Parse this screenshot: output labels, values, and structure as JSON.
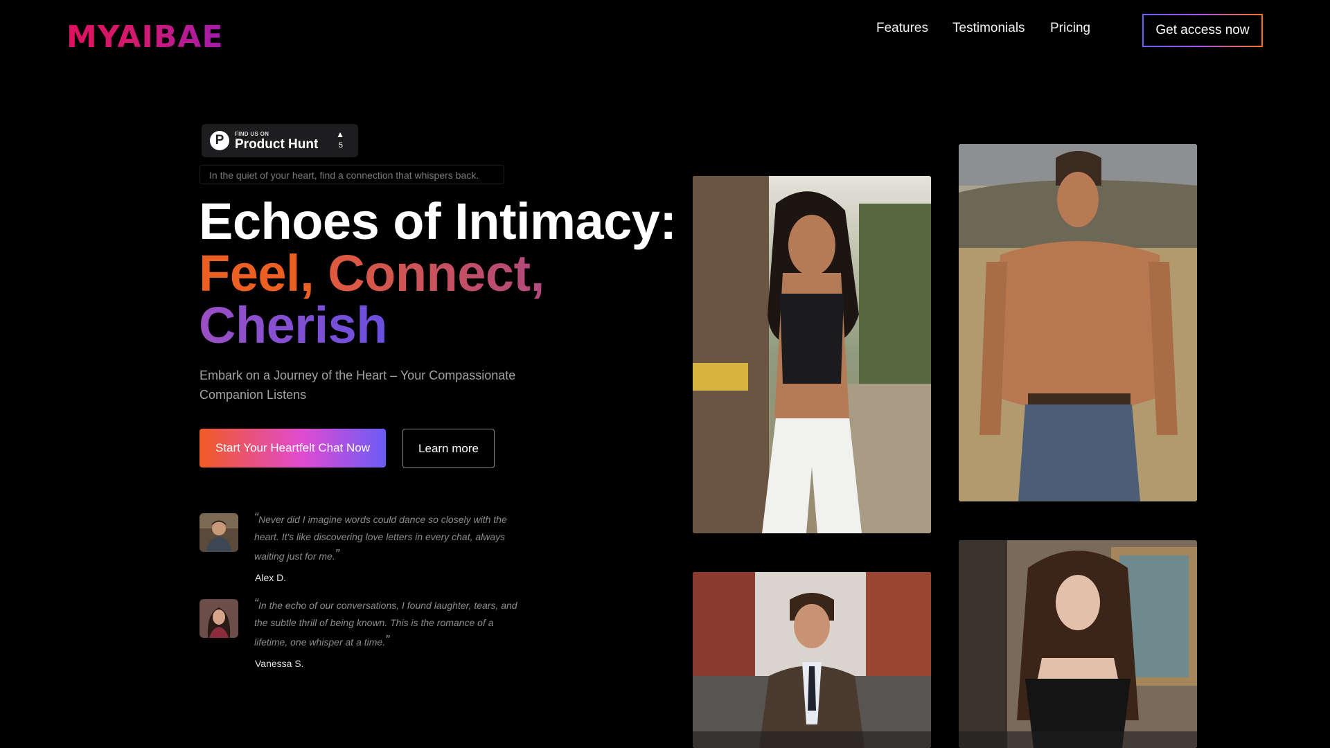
{
  "brand": {
    "logo_text": "MYAIBAE"
  },
  "nav": {
    "links": [
      "Features",
      "Testimonials",
      "Pricing"
    ],
    "cta_label": "Get access now"
  },
  "product_hunt": {
    "small_label": "FIND US ON",
    "title": "Product Hunt",
    "logo_letter": "P",
    "arrow": "▲",
    "upvotes": "5"
  },
  "hero": {
    "tagline": "In the quiet of your heart, find a connection that whispers back.",
    "headline_line1": "Echoes of Intimacy:",
    "headline_feel": "Feel,",
    "headline_connect": "Connect,",
    "headline_cherish": "Cherish",
    "subtitle": "Embark on a Journey of the Heart – Your Compassionate Companion Listens",
    "primary_button": "Start Your Heartfelt Chat Now",
    "secondary_button": "Learn more"
  },
  "testimonials": [
    {
      "quote": "Never did I imagine words could dance so closely with the heart. It's like discovering love letters in every chat, always waiting just for me.",
      "author": "Alex D."
    },
    {
      "quote": "In the echo of our conversations, I found laughter, tears, and the subtle thrill of being known. This is the romance of a lifetime, one whisper at a time.",
      "author": "Vanessa S."
    }
  ],
  "colors": {
    "background": "#000000",
    "brand_pink": "#e0115f",
    "accent_orange": "#ec5f22",
    "accent_purple": "#6a4fe0"
  }
}
